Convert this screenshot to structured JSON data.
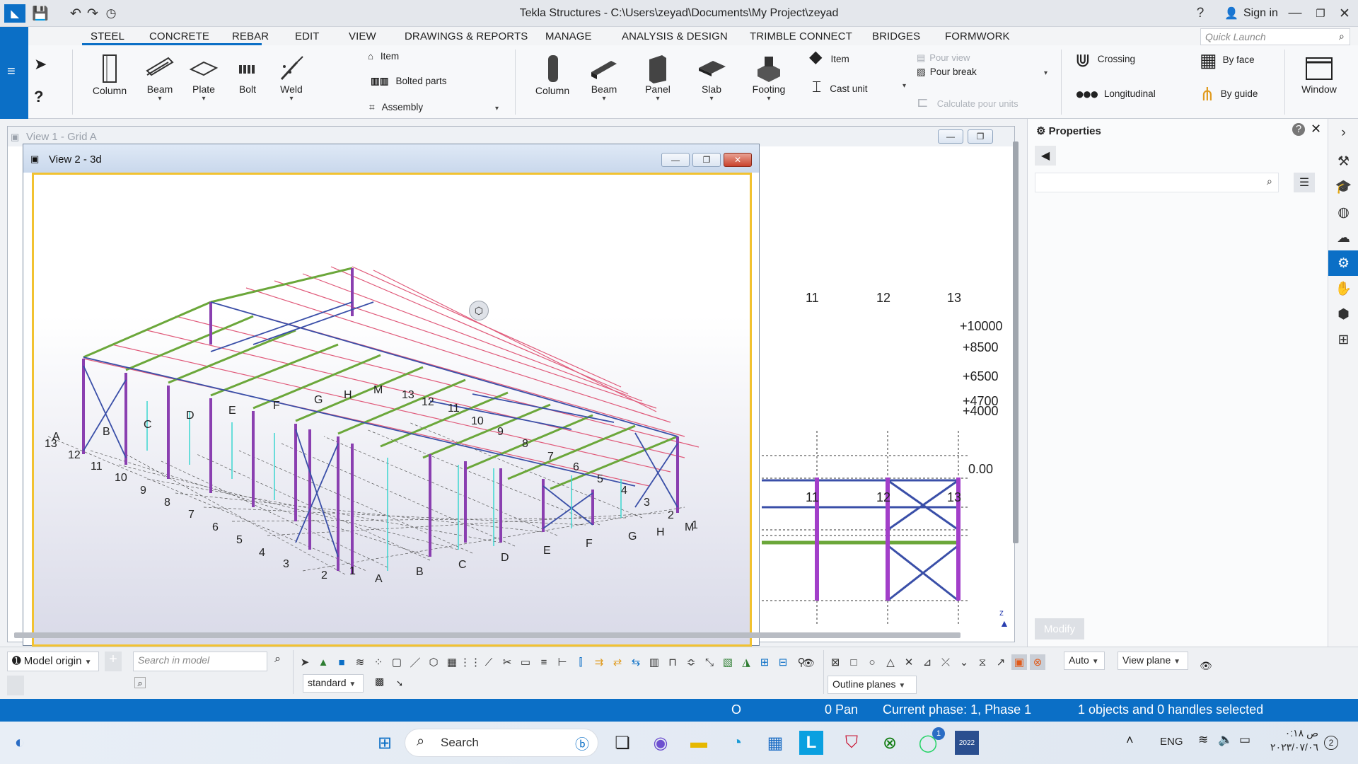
{
  "window": {
    "title": "Tekla Structures - C:\\Users\\zeyad\\Documents\\My Project\\zeyad",
    "sign_in": "Sign in"
  },
  "tabs": [
    "STEEL",
    "CONCRETE",
    "REBAR",
    "EDIT",
    "VIEW",
    "DRAWINGS & REPORTS",
    "MANAGE",
    "ANALYSIS & DESIGN",
    "TRIMBLE CONNECT",
    "BRIDGES",
    "FORMWORK"
  ],
  "quick_launch": {
    "placeholder": "Quick Launch"
  },
  "ribbon": {
    "steel": {
      "column": "Column",
      "beam": "Beam",
      "plate": "Plate",
      "bolt": "Bolt",
      "weld": "Weld",
      "item": "Item",
      "bolted_parts": "Bolted parts",
      "assembly": "Assembly"
    },
    "concrete": {
      "column": "Column",
      "beam": "Beam",
      "panel": "Panel",
      "slab": "Slab",
      "footing": "Footing",
      "item": "Item",
      "cast_unit": "Cast unit",
      "pour_view": "Pour view",
      "pour_break": "Pour break",
      "calc_pour": "Calculate pour units"
    },
    "rebar": {
      "crossing": "Crossing",
      "longitudinal": "Longitudinal",
      "by_face": "By face",
      "by_guide": "By guide"
    },
    "window": "Window"
  },
  "views": {
    "view1_title": "View 1 - Grid A",
    "view2_title": "View 2 - 3d",
    "grid_axis_top": [
      "11",
      "12",
      "13"
    ],
    "grid_axis_bottom": [
      "11",
      "12",
      "13"
    ],
    "levels": [
      "+10000",
      "+8500",
      "+6500",
      "+4700",
      "+4000",
      "0.00"
    ],
    "axis_z": "z",
    "grid_letters": [
      "A",
      "B",
      "C",
      "D",
      "E",
      "F",
      "G",
      "H",
      "M"
    ],
    "grid_numbers": [
      "13",
      "12",
      "11",
      "10",
      "9",
      "8",
      "7",
      "6",
      "5",
      "4",
      "3",
      "2",
      "1"
    ]
  },
  "properties": {
    "title": "Properties",
    "modify": "Modify"
  },
  "bottom": {
    "model_origin": "Model origin",
    "search_placeholder": "Search in model",
    "standard": "standard",
    "auto": "Auto",
    "view_plane": "View plane",
    "outline_planes": "Outline planes"
  },
  "status": {
    "o": "O",
    "pan": "0  Pan",
    "phase": "Current phase: 1, Phase 1",
    "selection": "1 objects and 0 handles selected"
  },
  "taskbar": {
    "search": "Search",
    "lang": "ENG",
    "time": "۰:۱۸ ص",
    "date": "۲۰۲۳/۰۷/۰٦",
    "notifications": "2",
    "app_badge": "1",
    "tekla_badge": "2022"
  },
  "colors": {
    "accent": "#0b6fc6",
    "highlight": "#f2c230",
    "column": "#8a3fb0",
    "beam": "#3a4fa8",
    "purlin": "#e05a7a",
    "green": "#6ba73a",
    "cyan": "#3bd6d0"
  }
}
